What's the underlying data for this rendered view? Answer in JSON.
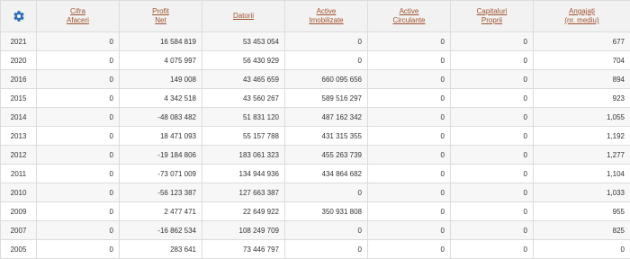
{
  "header": {
    "settings_icon": "gear-icon",
    "accent_color": "#2f6db5",
    "link_color": "#a0522d",
    "columns": [
      {
        "line1": "Cifra",
        "line2": "Afaceri"
      },
      {
        "line1": "Profit",
        "line2": "Net"
      },
      {
        "line1": "Datorii",
        "line2": ""
      },
      {
        "line1": "Active",
        "line2": "Imobilizate"
      },
      {
        "line1": "Active",
        "line2": "Circulante"
      },
      {
        "line1": "Capitaluri",
        "line2": "Proprii"
      },
      {
        "line1": "Angajați",
        "line2": "(nr. mediu)"
      }
    ]
  },
  "rows": [
    [
      "2021",
      "0",
      "16 584 819",
      "53 453 054",
      "0",
      "0",
      "0",
      "677"
    ],
    [
      "2020",
      "0",
      "4 075 997",
      "56 430 929",
      "0",
      "0",
      "0",
      "704"
    ],
    [
      "2016",
      "0",
      "149 008",
      "43 465 659",
      "660 095 656",
      "0",
      "0",
      "894"
    ],
    [
      "2015",
      "0",
      "4 342 518",
      "43 560 267",
      "589 516 297",
      "0",
      "0",
      "923"
    ],
    [
      "2014",
      "0",
      "-48 083 482",
      "51 831 120",
      "487 162 342",
      "0",
      "0",
      "1,055"
    ],
    [
      "2013",
      "0",
      "18 471 093",
      "55 157 788",
      "431 315 355",
      "0",
      "0",
      "1,192"
    ],
    [
      "2012",
      "0",
      "-19 184 806",
      "183 061 323",
      "455 263 739",
      "0",
      "0",
      "1,277"
    ],
    [
      "2011",
      "0",
      "-73 071 009",
      "134 944 936",
      "434 864 682",
      "0",
      "0",
      "1,104"
    ],
    [
      "2010",
      "0",
      "-56 123 387",
      "127 663 387",
      "0",
      "0",
      "0",
      "1,033"
    ],
    [
      "2009",
      "0",
      "2 477 471",
      "22 649 922",
      "350 931 808",
      "0",
      "0",
      "955"
    ],
    [
      "2007",
      "0",
      "-16 862 534",
      "108 249 709",
      "0",
      "0",
      "0",
      "825"
    ],
    [
      "2005",
      "0",
      "283 641",
      "73 446 797",
      "0",
      "0",
      "0",
      "0"
    ]
  ]
}
